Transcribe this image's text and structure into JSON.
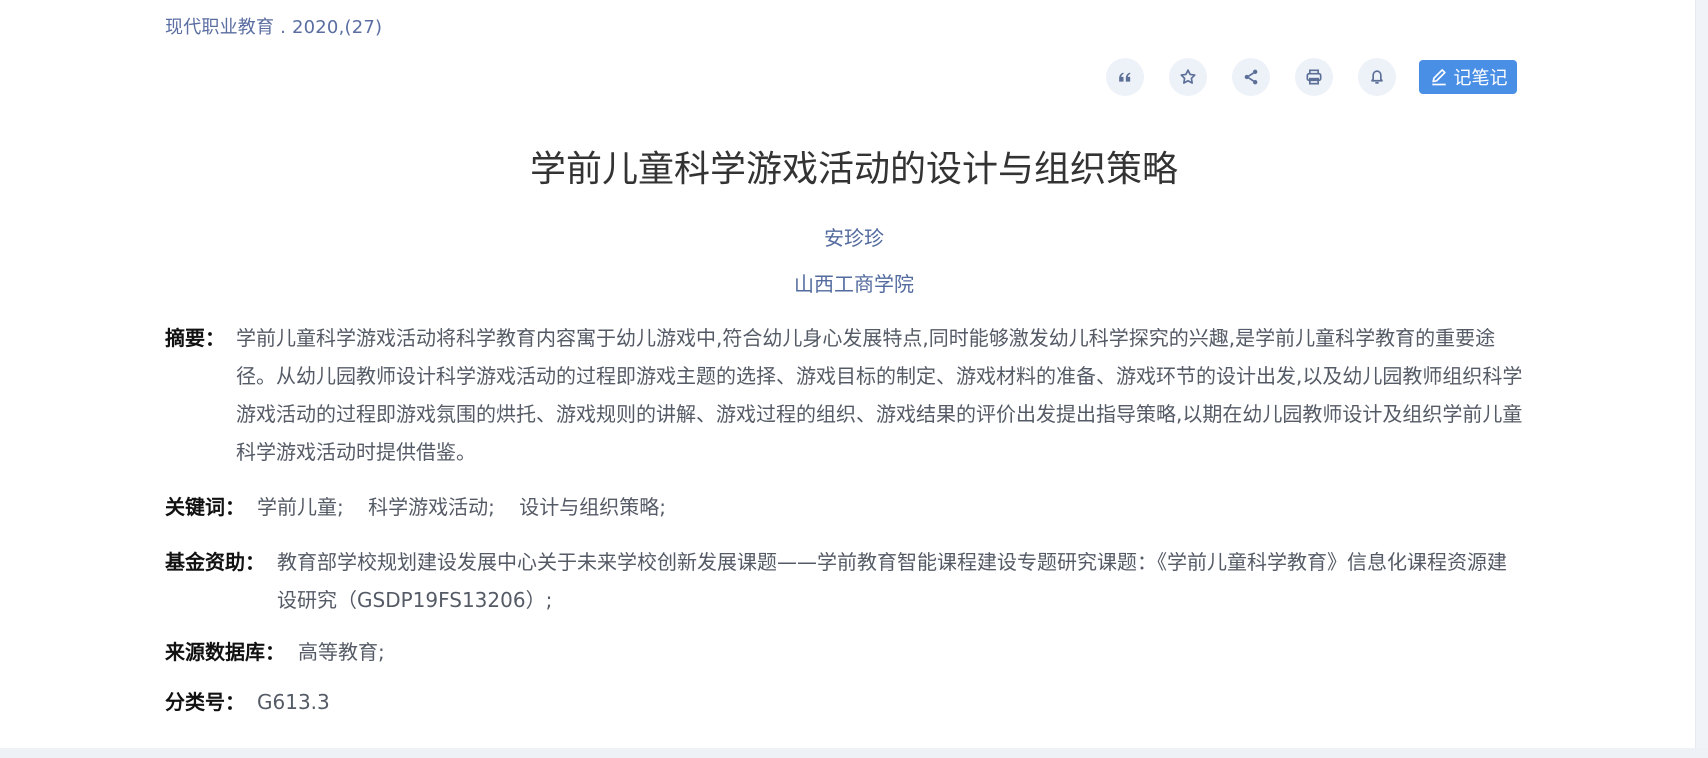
{
  "header": {
    "source": "现代职业教育 . 2020,(27)"
  },
  "toolbar": {
    "icons": [
      {
        "name": "quote-icon"
      },
      {
        "name": "star-icon"
      },
      {
        "name": "share-icon"
      },
      {
        "name": "print-icon"
      },
      {
        "name": "bell-icon"
      }
    ],
    "note_label": "记笔记",
    "accent_color": "#4a8fe6"
  },
  "article": {
    "title": "学前儿童科学游戏活动的设计与组织策略",
    "author": "安珍珍",
    "institution": "山西工商学院",
    "abstract_label": "摘要：",
    "abstract": "学前儿童科学游戏活动将科学教育内容寓于幼儿游戏中,符合幼儿身心发展特点,同时能够激发幼儿科学探究的兴趣,是学前儿童科学教育的重要途径。从幼儿园教师设计科学游戏活动的过程即游戏主题的选择、游戏目标的制定、游戏材料的准备、游戏环节的设计出发,以及幼儿园教师组织科学游戏活动的过程即游戏氛围的烘托、游戏规则的讲解、游戏过程的组织、游戏结果的评价出发提出指导策略,以期在幼儿园教师设计及组织学前儿童科学游戏活动时提供借鉴。",
    "keywords_label": "关键词：",
    "keywords": [
      "学前儿童;",
      "科学游戏活动;",
      "设计与组织策略;"
    ],
    "fund_label": "基金资助：",
    "fund": "教育部学校规划建设发展中心关于未来学校创新发展课题——学前教育智能课程建设专题研究课题：《学前儿童科学教育》信息化课程资源建设研究（GSDP19FS13206）;",
    "database_label": "来源数据库：",
    "database": "高等教育;",
    "classification_label": "分类号：",
    "classification": "G613.3"
  },
  "colors": {
    "link_blue": "#536b9f",
    "text_gray": "#555b66",
    "label_black": "#111111",
    "icon_bg": "#edf1f8"
  }
}
